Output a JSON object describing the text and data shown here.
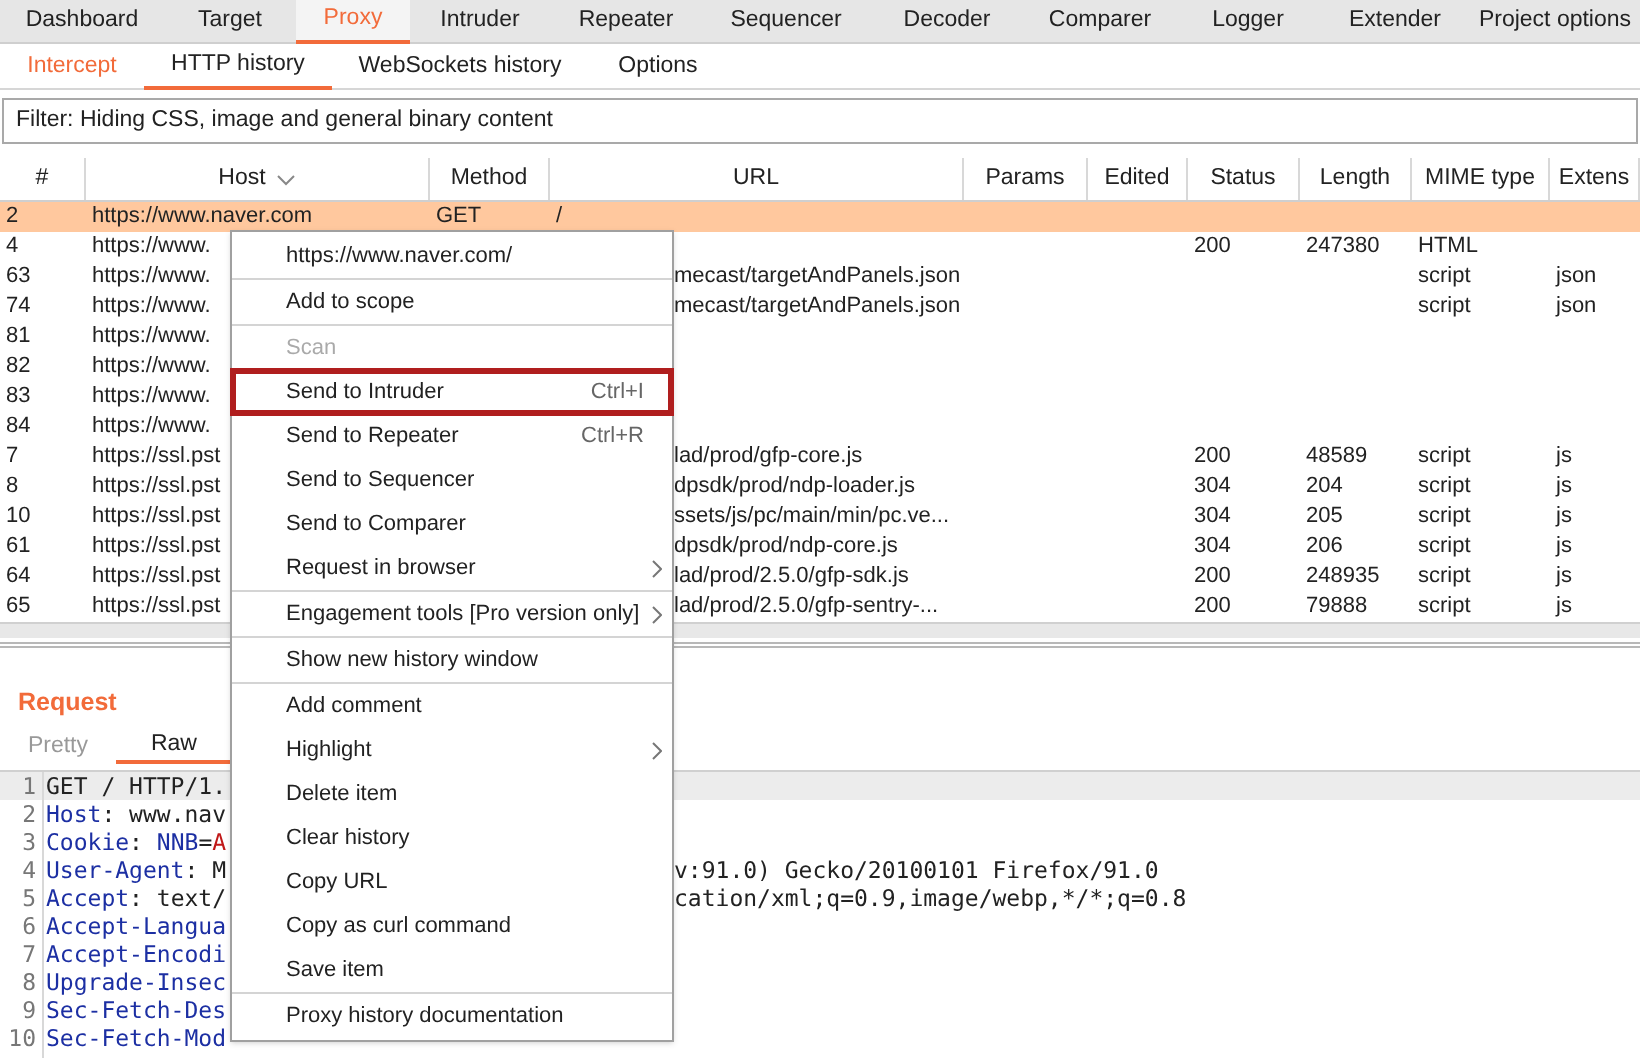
{
  "main_tabs": [
    {
      "label": "Dashboard",
      "selected": false
    },
    {
      "label": "Target",
      "selected": false
    },
    {
      "label": "Proxy",
      "selected": true
    },
    {
      "label": "Intruder",
      "selected": false
    },
    {
      "label": "Repeater",
      "selected": false
    },
    {
      "label": "Sequencer",
      "selected": false
    },
    {
      "label": "Decoder",
      "selected": false
    },
    {
      "label": "Comparer",
      "selected": false
    },
    {
      "label": "Logger",
      "selected": false
    },
    {
      "label": "Extender",
      "selected": false
    },
    {
      "label": "Project options",
      "selected": false
    }
  ],
  "sub_tabs": [
    {
      "label": "Intercept",
      "selected": false,
      "alert": true
    },
    {
      "label": "HTTP history",
      "selected": true,
      "alert": false
    },
    {
      "label": "WebSockets history",
      "selected": false,
      "alert": false
    },
    {
      "label": "Options",
      "selected": false,
      "alert": false
    }
  ],
  "filter": "Filter: Hiding CSS, image and general binary content",
  "table": {
    "columns": [
      {
        "label": "#",
        "sorted": false
      },
      {
        "label": "Host",
        "sorted": true
      },
      {
        "label": "Method",
        "sorted": false
      },
      {
        "label": "URL",
        "sorted": false
      },
      {
        "label": "Params",
        "sorted": false
      },
      {
        "label": "Edited",
        "sorted": false
      },
      {
        "label": "Status",
        "sorted": false
      },
      {
        "label": "Length",
        "sorted": false
      },
      {
        "label": "MIME type",
        "sorted": false
      },
      {
        "label": "Extens",
        "sorted": false
      }
    ],
    "rows": [
      {
        "number": "2",
        "host": "https://www.naver.com",
        "method": "GET",
        "url": "/",
        "selected": true,
        "covered": false
      },
      {
        "number": "4",
        "host": "https://www.",
        "status": "200",
        "length": "247380",
        "mime_type": "HTML",
        "selected": false
      },
      {
        "number": "63",
        "host": "https://www.",
        "url": "mecast/targetAndPanels.json",
        "mime_type": "script",
        "extension": "json",
        "selected": false,
        "covered": true
      },
      {
        "number": "74",
        "host": "https://www.",
        "url": "mecast/targetAndPanels.json",
        "mime_type": "script",
        "extension": "json",
        "selected": false,
        "covered": true
      },
      {
        "number": "81",
        "host": "https://www.",
        "selected": false
      },
      {
        "number": "82",
        "host": "https://www.",
        "selected": false
      },
      {
        "number": "83",
        "host": "https://www.",
        "selected": false
      },
      {
        "number": "84",
        "host": "https://www.",
        "selected": false
      },
      {
        "number": "7",
        "host": "https://ssl.pst",
        "url": "lad/prod/gfp-core.js",
        "status": "200",
        "length": "48589",
        "mime_type": "script",
        "extension": "js",
        "selected": false,
        "covered": true
      },
      {
        "number": "8",
        "host": "https://ssl.pst",
        "url": "dpsdk/prod/ndp-loader.js",
        "status": "304",
        "length": "204",
        "mime_type": "script",
        "extension": "js",
        "selected": false,
        "covered": true
      },
      {
        "number": "10",
        "host": "https://ssl.pst",
        "url": "ssets/js/pc/main/min/pc.ve...",
        "status": "304",
        "length": "205",
        "mime_type": "script",
        "extension": "js",
        "selected": false,
        "covered": true
      },
      {
        "number": "61",
        "host": "https://ssl.pst",
        "url": "dpsdk/prod/ndp-core.js",
        "status": "304",
        "length": "206",
        "mime_type": "script",
        "extension": "js",
        "selected": false,
        "covered": true
      },
      {
        "number": "64",
        "host": "https://ssl.pst",
        "url": "lad/prod/2.5.0/gfp-sdk.js",
        "status": "200",
        "length": "248935",
        "mime_type": "script",
        "extension": "js",
        "selected": false,
        "covered": true
      },
      {
        "number": "65",
        "host": "https://ssl.pst",
        "url": "lad/prod/2.5.0/gfp-sentry-...",
        "status": "200",
        "length": "79888",
        "mime_type": "script",
        "extension": "js",
        "selected": false,
        "covered": true
      }
    ]
  },
  "request": {
    "title": "Request",
    "tabs": [
      {
        "label": "Pretty",
        "selected": false
      },
      {
        "label": "Raw",
        "selected": true
      }
    ],
    "lines": [
      {
        "number": "1",
        "current": true,
        "left": [
          {
            "kind": "plain",
            "text": "GET / HTTP/1."
          }
        ]
      },
      {
        "number": "2",
        "current": false,
        "left": [
          {
            "kind": "name",
            "text": "Host"
          },
          {
            "kind": "plain",
            "text": ": www.nav"
          }
        ]
      },
      {
        "number": "3",
        "current": false,
        "left": [
          {
            "kind": "name",
            "text": "Cookie"
          },
          {
            "kind": "plain",
            "text": ": "
          },
          {
            "kind": "name",
            "text": "NNB"
          },
          {
            "kind": "plain",
            "text": "="
          },
          {
            "kind": "value",
            "text": "A"
          }
        ]
      },
      {
        "number": "4",
        "current": false,
        "left": [
          {
            "kind": "name",
            "text": "User-Agent"
          },
          {
            "kind": "plain",
            "text": ": M"
          }
        ],
        "right": "v:91.0) Gecko/20100101 Firefox/91.0"
      },
      {
        "number": "5",
        "current": false,
        "left": [
          {
            "kind": "name",
            "text": "Accept"
          },
          {
            "kind": "plain",
            "text": ": text/"
          }
        ],
        "right": "cation/xml;q=0.9,image/webp,*/*;q=0.8"
      },
      {
        "number": "6",
        "current": false,
        "left": [
          {
            "kind": "name",
            "text": "Accept-Langua"
          }
        ]
      },
      {
        "number": "7",
        "current": false,
        "left": [
          {
            "kind": "name",
            "text": "Accept-Encodi"
          }
        ]
      },
      {
        "number": "8",
        "current": false,
        "left": [
          {
            "kind": "name",
            "text": "Upgrade-Insec"
          }
        ]
      },
      {
        "number": "9",
        "current": false,
        "left": [
          {
            "kind": "name",
            "text": "Sec-Fetch-Des"
          }
        ]
      },
      {
        "number": "10",
        "current": false,
        "left": [
          {
            "kind": "name",
            "text": "Sec-Fetch-Mod"
          }
        ]
      }
    ]
  },
  "context_menu": {
    "groups": [
      [
        {
          "label": "https://www.naver.com/",
          "disabled": false,
          "highlighted": false,
          "submenu": false
        }
      ],
      [
        {
          "label": "Add to scope",
          "disabled": false,
          "highlighted": false,
          "submenu": false
        }
      ],
      [
        {
          "label": "Scan",
          "disabled": true,
          "highlighted": false,
          "submenu": false
        },
        {
          "label": "Send to Intruder",
          "shortcut": "Ctrl+I",
          "disabled": false,
          "highlighted": true,
          "submenu": false
        },
        {
          "label": "Send to Repeater",
          "shortcut": "Ctrl+R",
          "disabled": false,
          "highlighted": false,
          "submenu": false
        },
        {
          "label": "Send to Sequencer",
          "disabled": false,
          "highlighted": false,
          "submenu": false
        },
        {
          "label": "Send to Comparer",
          "disabled": false,
          "highlighted": false,
          "submenu": false
        },
        {
          "label": "Request in browser",
          "disabled": false,
          "highlighted": false,
          "submenu": true
        }
      ],
      [
        {
          "label": "Engagement tools [Pro version only]",
          "disabled": false,
          "highlighted": false,
          "submenu": true
        }
      ],
      [
        {
          "label": "Show new history window",
          "disabled": false,
          "highlighted": false,
          "submenu": false
        }
      ],
      [
        {
          "label": "Add comment",
          "disabled": false,
          "highlighted": false,
          "submenu": false
        },
        {
          "label": "Highlight",
          "disabled": false,
          "highlighted": false,
          "submenu": true
        },
        {
          "label": "Delete item",
          "disabled": false,
          "highlighted": false,
          "submenu": false
        },
        {
          "label": "Clear history",
          "disabled": false,
          "highlighted": false,
          "submenu": false
        },
        {
          "label": "Copy URL",
          "disabled": false,
          "highlighted": false,
          "submenu": false
        },
        {
          "label": "Copy as curl command",
          "disabled": false,
          "highlighted": false,
          "submenu": false
        },
        {
          "label": "Save item",
          "disabled": false,
          "highlighted": false,
          "submenu": false
        }
      ],
      [
        {
          "label": "Proxy history documentation",
          "disabled": false,
          "highlighted": false,
          "submenu": false
        }
      ]
    ]
  }
}
